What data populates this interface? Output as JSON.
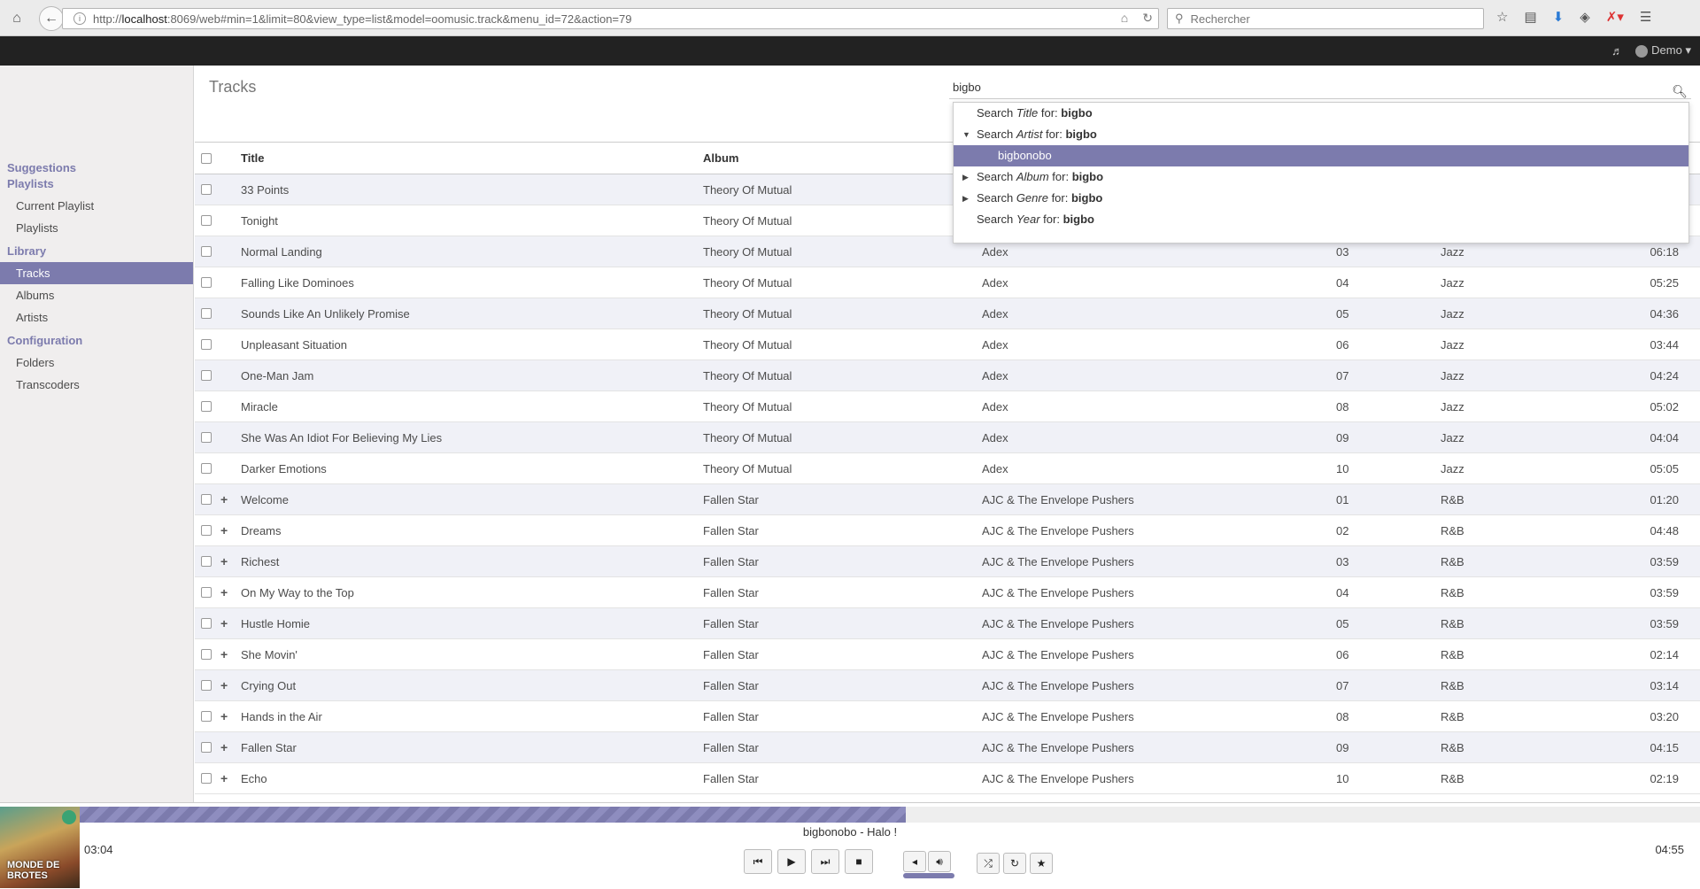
{
  "browser": {
    "url_host": "localhost",
    "url_rest": ":8069/web#min=1&limit=80&view_type=list&model=oomusic.track&menu_id=72&action=79",
    "url_prefix": "http://",
    "search_placeholder": "Rechercher"
  },
  "app": {
    "user": "Demo"
  },
  "sidebar": {
    "sections": [
      {
        "header": "Suggestions",
        "items": []
      },
      {
        "header": "Playlists",
        "items": [
          "Current Playlist",
          "Playlists"
        ]
      },
      {
        "header": "Library",
        "items": [
          "Tracks",
          "Albums",
          "Artists"
        ]
      },
      {
        "header": "Configuration",
        "items": [
          "Folders",
          "Transcoders"
        ]
      }
    ],
    "active": "Tracks"
  },
  "main": {
    "title": "Tracks",
    "search_value": "bigbo"
  },
  "dropdown": {
    "items": [
      {
        "prefix": "Search ",
        "field": "Title",
        "mid": " for: ",
        "term": "bigbo",
        "caret": ""
      },
      {
        "prefix": "Search ",
        "field": "Artist",
        "mid": " for: ",
        "term": "bigbo",
        "caret": "▼"
      },
      {
        "sub": "bigbonobo"
      },
      {
        "prefix": "Search ",
        "field": "Album",
        "mid": " for: ",
        "term": "bigbo",
        "caret": "▶"
      },
      {
        "prefix": "Search ",
        "field": "Genre",
        "mid": " for: ",
        "term": "bigbo",
        "caret": "▶"
      },
      {
        "prefix": "Search ",
        "field": "Year",
        "mid": " for: ",
        "term": "bigbo",
        "caret": ""
      }
    ]
  },
  "table": {
    "headers": {
      "title": "Title",
      "album": "Album"
    },
    "rows": [
      {
        "expand": "",
        "title": "33 Points",
        "album": "Theory Of Mutual",
        "artist": "",
        "num": "",
        "genre": "",
        "dur": ""
      },
      {
        "expand": "",
        "title": "Tonight",
        "album": "Theory Of Mutual",
        "artist": "",
        "num": "",
        "genre": "",
        "dur": ""
      },
      {
        "expand": "",
        "title": "Normal Landing",
        "album": "Theory Of Mutual",
        "artist": "Adex",
        "num": "03",
        "genre": "Jazz",
        "dur": "06:18"
      },
      {
        "expand": "",
        "title": "Falling Like Dominoes",
        "album": "Theory Of Mutual",
        "artist": "Adex",
        "num": "04",
        "genre": "Jazz",
        "dur": "05:25"
      },
      {
        "expand": "",
        "title": "Sounds Like An Unlikely Promise",
        "album": "Theory Of Mutual",
        "artist": "Adex",
        "num": "05",
        "genre": "Jazz",
        "dur": "04:36"
      },
      {
        "expand": "",
        "title": "Unpleasant Situation",
        "album": "Theory Of Mutual",
        "artist": "Adex",
        "num": "06",
        "genre": "Jazz",
        "dur": "03:44"
      },
      {
        "expand": "",
        "title": "One-Man Jam",
        "album": "Theory Of Mutual",
        "artist": "Adex",
        "num": "07",
        "genre": "Jazz",
        "dur": "04:24"
      },
      {
        "expand": "",
        "title": "Miracle",
        "album": "Theory Of Mutual",
        "artist": "Adex",
        "num": "08",
        "genre": "Jazz",
        "dur": "05:02"
      },
      {
        "expand": "",
        "title": "She Was An Idiot For Believing My Lies",
        "album": "Theory Of Mutual",
        "artist": "Adex",
        "num": "09",
        "genre": "Jazz",
        "dur": "04:04"
      },
      {
        "expand": "",
        "title": "Darker Emotions",
        "album": "Theory Of Mutual",
        "artist": "Adex",
        "num": "10",
        "genre": "Jazz",
        "dur": "05:05"
      },
      {
        "expand": "+",
        "title": "Welcome",
        "album": "Fallen Star",
        "artist": "AJC & The Envelope Pushers",
        "num": "01",
        "genre": "R&B",
        "dur": "01:20"
      },
      {
        "expand": "+",
        "title": "Dreams",
        "album": "Fallen Star",
        "artist": "AJC & The Envelope Pushers",
        "num": "02",
        "genre": "R&B",
        "dur": "04:48"
      },
      {
        "expand": "+",
        "title": "Richest",
        "album": "Fallen Star",
        "artist": "AJC & The Envelope Pushers",
        "num": "03",
        "genre": "R&B",
        "dur": "03:59"
      },
      {
        "expand": "+",
        "title": "On My Way to the Top",
        "album": "Fallen Star",
        "artist": "AJC & The Envelope Pushers",
        "num": "04",
        "genre": "R&B",
        "dur": "03:59"
      },
      {
        "expand": "+",
        "title": "Hustle Homie",
        "album": "Fallen Star",
        "artist": "AJC & The Envelope Pushers",
        "num": "05",
        "genre": "R&B",
        "dur": "03:59"
      },
      {
        "expand": "+",
        "title": "She Movin'",
        "album": "Fallen Star",
        "artist": "AJC & The Envelope Pushers",
        "num": "06",
        "genre": "R&B",
        "dur": "02:14"
      },
      {
        "expand": "+",
        "title": "Crying Out",
        "album": "Fallen Star",
        "artist": "AJC & The Envelope Pushers",
        "num": "07",
        "genre": "R&B",
        "dur": "03:14"
      },
      {
        "expand": "+",
        "title": "Hands in the Air",
        "album": "Fallen Star",
        "artist": "AJC & The Envelope Pushers",
        "num": "08",
        "genre": "R&B",
        "dur": "03:20"
      },
      {
        "expand": "+",
        "title": "Fallen Star",
        "album": "Fallen Star",
        "artist": "AJC & The Envelope Pushers",
        "num": "09",
        "genre": "R&B",
        "dur": "04:15"
      },
      {
        "expand": "+",
        "title": "Echo",
        "album": "Fallen Star",
        "artist": "AJC & The Envelope Pushers",
        "num": "10",
        "genre": "R&B",
        "dur": "02:19"
      }
    ]
  },
  "player": {
    "now_playing": "bigbonobo - Halo !",
    "time_current": "03:04",
    "time_total": "04:55",
    "progress_fraction": 0.51,
    "cover_text": "MONDE DE BROTES",
    "accent": "#7c7bad"
  }
}
